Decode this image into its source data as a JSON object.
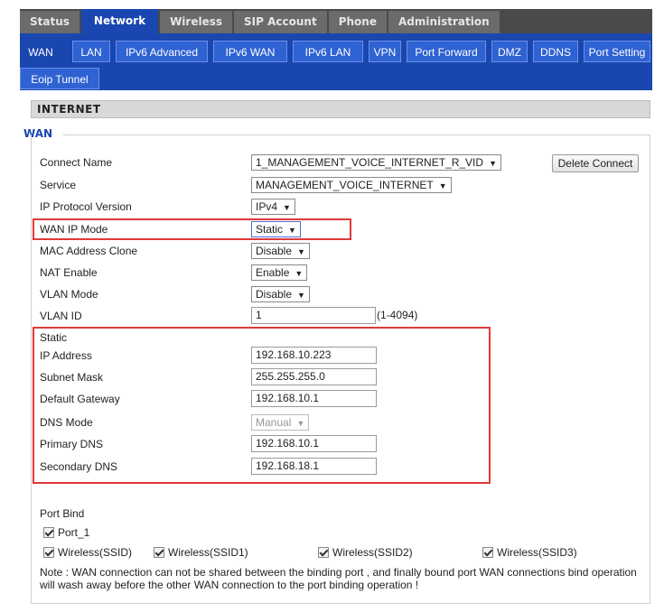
{
  "top_tabs": [
    "Status",
    "Network",
    "Wireless",
    "SIP Account",
    "Phone",
    "Administration"
  ],
  "top_active": "Network",
  "sub_tabs": [
    "WAN",
    "LAN",
    "IPv6 Advanced",
    "IPv6 WAN",
    "IPv6 LAN",
    "VPN",
    "Port Forward",
    "DMZ",
    "DDNS",
    "Port Setting",
    "Eoip Tunnel"
  ],
  "sub_active": "WAN",
  "section_title": "INTERNET",
  "wan_title": "WAN",
  "fields": {
    "connect_name": {
      "label": "Connect Name",
      "value": "1_MANAGEMENT_VOICE_INTERNET_R_VID"
    },
    "service": {
      "label": "Service",
      "value": "MANAGEMENT_VOICE_INTERNET"
    },
    "ip_protocol": {
      "label": "IP Protocol Version",
      "value": "IPv4"
    },
    "wan_ip_mode": {
      "label": "WAN IP Mode",
      "value": "Static"
    },
    "mac_clone": {
      "label": "MAC Address Clone",
      "value": "Disable"
    },
    "nat": {
      "label": "NAT Enable",
      "value": "Enable"
    },
    "vlan_mode": {
      "label": "VLAN Mode",
      "value": "Disable"
    },
    "vlan_id": {
      "label": "VLAN ID",
      "value": "1",
      "hint": "(1-4094)"
    }
  },
  "delete_button": "Delete Connect",
  "static": {
    "title": "Static",
    "ip": {
      "label": "IP Address",
      "value": "192.168.10.223"
    },
    "mask": {
      "label": "Subnet Mask",
      "value": "255.255.255.0"
    },
    "gateway": {
      "label": "Default Gateway",
      "value": "192.168.10.1"
    },
    "dns_mode": {
      "label": "DNS Mode",
      "value": "Manual"
    },
    "primary_dns": {
      "label": "Primary DNS",
      "value": "192.168.10.1"
    },
    "secondary_dns": {
      "label": "Secondary DNS",
      "value": "192.168.18.1"
    }
  },
  "port_bind": {
    "title": "Port Bind",
    "ports": [
      "Port_1",
      "Wireless(SSID)",
      "Wireless(SSID1)",
      "Wireless(SSID2)",
      "Wireless(SSID3)"
    ]
  },
  "note": "Note : WAN connection can not be shared between the binding port , and finally bound port WAN connections bind operation will wash away before the other WAN connection to the port binding operation !",
  "colors": {
    "accent_blue": "#1a46b0",
    "tab_blue": "#2f62d2",
    "highlight_red": "#e03a3a"
  }
}
